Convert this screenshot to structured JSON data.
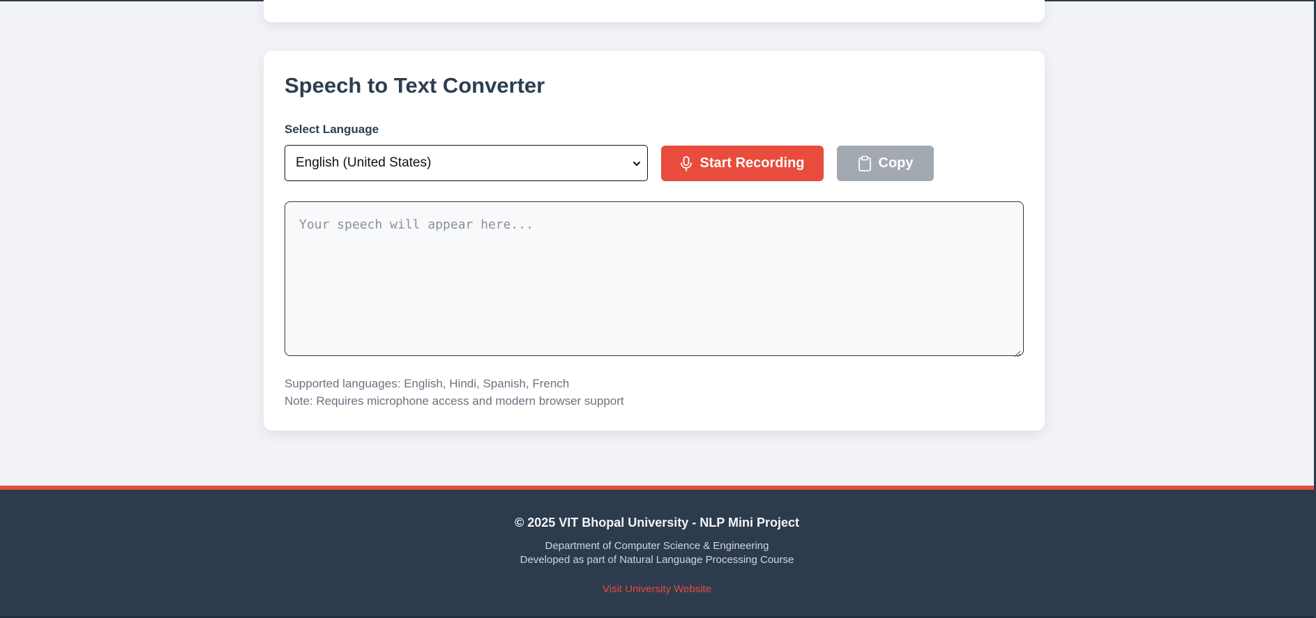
{
  "converter": {
    "title": "Speech to Text Converter",
    "language_label": "Select Language",
    "language_selected": "English (United States)",
    "record_button": "Start Recording",
    "copy_button": "Copy",
    "textarea_placeholder": "Your speech will appear here...",
    "supported_languages": "Supported languages: English, Hindi, Spanish, French",
    "note": "Note: Requires microphone access and modern browser support"
  },
  "footer": {
    "copyright": "© 2025 VIT Bhopal University - NLP Mini Project",
    "department": "Department of Computer Science & Engineering",
    "course": "Developed as part of Natural Language Processing Course",
    "link": "Visit University Website"
  },
  "icons": {
    "record": "microphone-icon",
    "copy": "clipboard-icon",
    "select": "chevron-down-icon"
  },
  "colors": {
    "accent": "#e74c3c",
    "footer_bg": "#2d3b4e",
    "copy_disabled": "#a3a9b1",
    "title": "#2c3e50"
  }
}
